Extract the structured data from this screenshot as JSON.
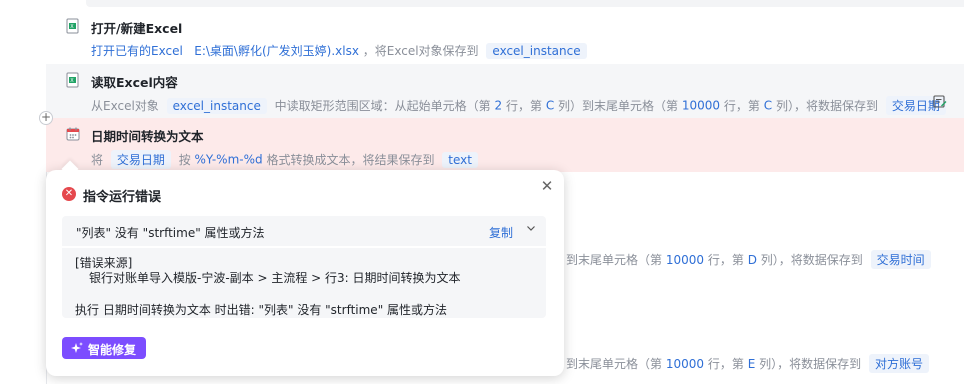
{
  "steps": [
    {
      "title": "打开/新建Excel",
      "desc_action": "打开已有的Excel",
      "desc_path": "E:\\桌面\\孵化(广发刘玉婷).xlsx",
      "desc_mid": "，将Excel对象保存到",
      "var": "excel_instance",
      "icon": "excel-open-icon"
    },
    {
      "title": "读取Excel内容",
      "desc_pre": "从Excel对象",
      "var_in": "excel_instance",
      "desc_mid1": "中读取矩形范围区域：从起始单元格（第",
      "start_row": "2",
      "desc_mid2": "行，第",
      "start_col": "C",
      "desc_mid3": "列）到末尾单元格（第",
      "end_row": "10000",
      "desc_mid4": "行，第",
      "end_col": "C",
      "desc_mid5": "列），将数据保存到",
      "var_out": "交易日期",
      "icon": "excel-read-icon"
    },
    {
      "title": "日期时间转换为文本",
      "desc_pre": "将",
      "var_in": "交易日期",
      "desc_mid1": "按",
      "format": "%Y-%m-%d",
      "desc_mid2": "格式转换成文本，将结果保存到",
      "var_out": "text",
      "icon": "calendar-icon"
    }
  ],
  "bg_rows": [
    {
      "pre": "到末尾单元格（第",
      "row": "10000",
      "mid": "行，第",
      "col": "D",
      "post": "列），将数据保存到",
      "var": "交易时间"
    },
    {
      "pre": "到末尾单元格（第",
      "row": "10000",
      "mid": "行，第",
      "col": "E",
      "post": "列），将数据保存到",
      "var": "对方账号"
    }
  ],
  "popup": {
    "title": "指令运行错误",
    "message": "\"列表\" 没有 \"strftime\" 属性或方法",
    "copy_label": "复制",
    "source_label": "[错误来源]",
    "source_path": "银行对账单导入模版-宁波-副本 > 主流程 > 行3: 日期时间转换为文本",
    "exec_error": "执行 日期时间转换为文本 时出错: \"列表\" 没有 \"strftime\" 属性或方法",
    "fix_label": "智能修复"
  },
  "colors": {
    "accent": "#2f6fd6",
    "error_row_bg": "#fdeaea",
    "error_icon": "#e5484d",
    "fix_button": "#7c4dff"
  }
}
